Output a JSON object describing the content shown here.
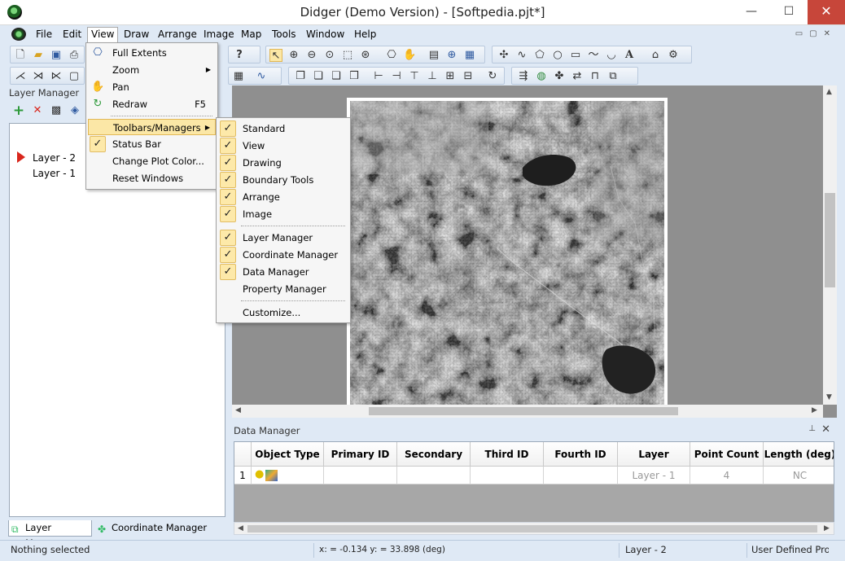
{
  "window": {
    "title": "Didger (Demo Version) - [Softpedia.pjt*]",
    "minimize": "—",
    "maximize": "☐",
    "close": "✕"
  },
  "menubar": {
    "items": [
      "File",
      "Edit",
      "View",
      "Draw",
      "Arrange",
      "Image",
      "Map",
      "Tools",
      "Window",
      "Help"
    ]
  },
  "view_menu": {
    "items": [
      {
        "label": "Full Extents",
        "icon": "full-extents-icon"
      },
      {
        "label": "Zoom",
        "submenu": true,
        "icon": ""
      },
      {
        "label": "Pan",
        "icon": "pan-hand-icon"
      },
      {
        "label": "Redraw",
        "shortcut": "F5",
        "icon": "redraw-icon"
      },
      {
        "label": "Toolbars/Managers",
        "submenu": true,
        "highlighted": true
      },
      {
        "label": "Status Bar",
        "checked": true
      },
      {
        "label": "Change Plot Color..."
      },
      {
        "label": "Reset Windows"
      }
    ]
  },
  "toolbars_menu": {
    "items": [
      {
        "label": "Standard",
        "checked": true
      },
      {
        "label": "View",
        "checked": true
      },
      {
        "label": "Drawing",
        "checked": true
      },
      {
        "label": "Boundary Tools",
        "checked": true
      },
      {
        "label": "Arrange",
        "checked": true
      },
      {
        "label": "Image",
        "checked": true
      },
      {
        "label": "Layer Manager",
        "checked": true
      },
      {
        "label": "Coordinate Manager",
        "checked": true
      },
      {
        "label": "Data Manager",
        "checked": true
      },
      {
        "label": "Property Manager",
        "checked": false
      },
      {
        "label": "Customize...",
        "checked": false
      }
    ]
  },
  "layer_manager": {
    "title": "Layer Manager",
    "layers": [
      "Layer - 2",
      "Layer - 1"
    ],
    "active_layer": "Layer - 2",
    "tabs": [
      "Layer Manager",
      "Coordinate Manager"
    ]
  },
  "data_manager": {
    "title": "Data Manager",
    "pin": "⊥",
    "close": "✕",
    "columns": [
      "Object Type",
      "Primary ID",
      "Secondary ID",
      "Third ID",
      "Fourth ID",
      "Layer",
      "Point Count",
      "Length (deg)"
    ],
    "rows": [
      {
        "index": "1",
        "primary": "",
        "secondary": "",
        "third": "",
        "fourth": "",
        "layer": "Layer - 1",
        "point_count": "4",
        "length": "NC"
      }
    ]
  },
  "statusbar": {
    "selection": "Nothing selected",
    "coords": "x: = -0.134 y: = 33.898 (deg)",
    "layer": "Layer - 2",
    "projection": "User Defined Proj"
  },
  "colors": {
    "accent_highlight": "#fbe7a6",
    "chrome": "#dfe9f5",
    "close_red": "#c7463a",
    "active_layer_arrow": "#d9261c"
  }
}
